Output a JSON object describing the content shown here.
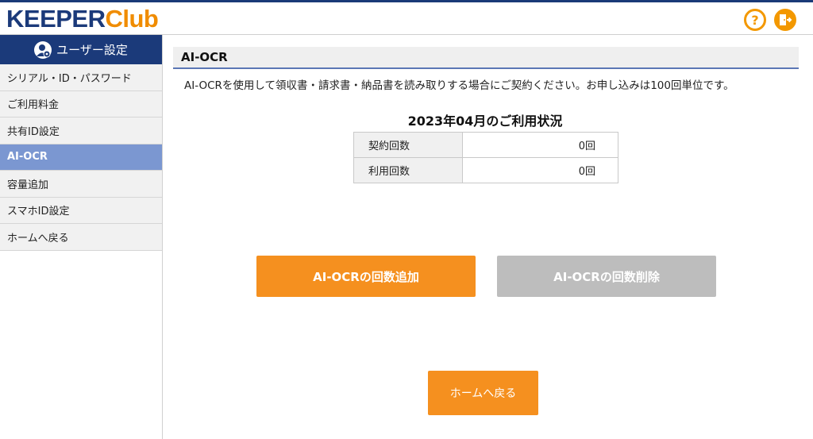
{
  "header": {
    "logo_main": "KEEPER",
    "logo_accent": "Club",
    "help_icon": "question-circle-icon",
    "logout_icon": "exit-door-icon",
    "accent_color": "#f39800",
    "brand_color": "#1b3a7a"
  },
  "sidebar": {
    "title": "ユーザー設定",
    "items": [
      {
        "label": "シリアル・ID・パスワード"
      },
      {
        "label": "ご利用料金"
      },
      {
        "label": "共有ID設定"
      },
      {
        "label": "AI-OCR",
        "active": true
      },
      {
        "label": "容量追加"
      },
      {
        "label": "スマホID設定"
      },
      {
        "label": "ホームへ戻る"
      }
    ]
  },
  "main": {
    "title": "AI-OCR",
    "description": "AI-OCRを使用して領収書・請求書・納品書を読み取りする場合にご契約ください。お申し込みは100回単位です。",
    "status_title": "2023年04月のご利用状況",
    "rows": [
      {
        "label": "契約回数",
        "value": "0回"
      },
      {
        "label": "利用回数",
        "value": "0回"
      }
    ],
    "add_button": "AI-OCRの回数追加",
    "delete_button": "AI-OCRの回数削除",
    "home_button": "ホームへ戻る"
  }
}
